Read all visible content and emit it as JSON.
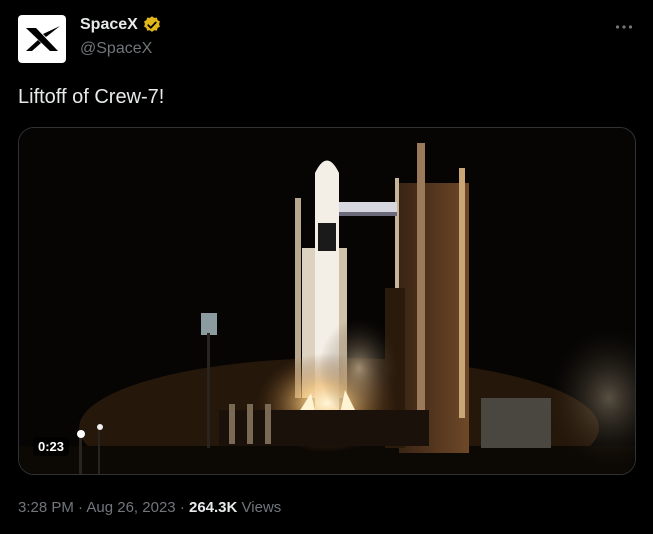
{
  "author": {
    "display_name": "SpaceX",
    "handle": "@SpaceX",
    "verified_color": "#e2b719",
    "avatar_icon": "spacex-x-logo-icon"
  },
  "more_icon": "more-dots-icon",
  "tweet": {
    "text": "Liftoff of Crew-7!"
  },
  "media": {
    "type": "video",
    "duration": "0:23",
    "scene": "rocket-launch-at-night"
  },
  "meta": {
    "time": "3:28 PM",
    "separator1": "·",
    "date": "Aug 26, 2023",
    "separator2": "·",
    "views_count": "264.3K",
    "views_label": "Views"
  },
  "colors": {
    "background": "#000000",
    "text_primary": "#e7e9ea",
    "text_secondary": "#71767b",
    "border": "#2f3336"
  }
}
